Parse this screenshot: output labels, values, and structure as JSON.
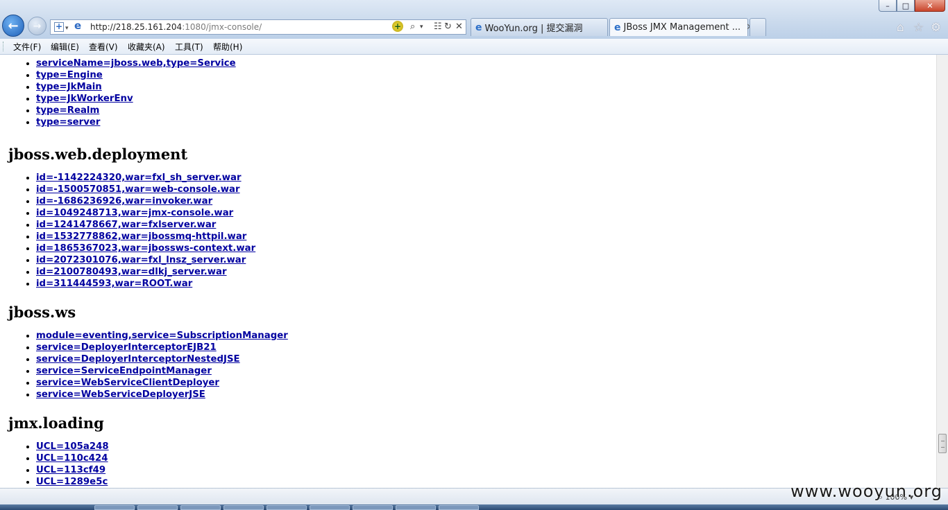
{
  "window": {
    "minimize": "–",
    "maximize": "□",
    "close": "✕"
  },
  "nav": {
    "back_icon": "back-arrow-icon",
    "forward_icon": "forward-arrow-icon"
  },
  "address_bar": {
    "url_host": "http://218.25.161.204",
    "url_rest": ":1080/jmx-console/"
  },
  "tabs": [
    {
      "label": "WooYun.org | 提交漏洞",
      "active": false
    },
    {
      "label": "JBoss JMX Management ...",
      "active": true
    }
  ],
  "menu": [
    "文件(F)",
    "编辑(E)",
    "查看(V)",
    "收藏夹(A)",
    "工具(T)",
    "帮助(H)"
  ],
  "sections": {
    "top_list": [
      "serviceName=jboss.web,type=Service",
      "type=Engine",
      "type=JkMain",
      "type=JkWorkerEnv",
      "type=Realm",
      "type=server"
    ],
    "web_deployment": {
      "heading": "jboss.web.deployment",
      "items": [
        "id=-1142224320,war=fxl_sh_server.war",
        "id=-1500570851,war=web-console.war",
        "id=-1686236926,war=invoker.war",
        "id=1049248713,war=jmx-console.war",
        "id=1241478667,war=fxlserver.war",
        "id=1532778862,war=jbossmq-httpil.war",
        "id=1865367023,war=jbossws-context.war",
        "id=2072301076,war=fxl_lnsz_server.war",
        "id=2100780493,war=dlkj_server.war",
        "id=311444593,war=ROOT.war"
      ]
    },
    "ws": {
      "heading": "jboss.ws",
      "items": [
        "module=eventing,service=SubscriptionManager",
        "service=DeployerInterceptorEJB21",
        "service=DeployerInterceptorNestedJSE",
        "service=ServiceEndpointManager",
        "service=WebServiceClientDeployer",
        "service=WebServiceDeployerJSE"
      ]
    },
    "loading": {
      "heading": "jmx.loading",
      "items": [
        "UCL=105a248",
        "UCL=110c424",
        "UCL=113cf49",
        "UCL=1289e5c"
      ]
    }
  },
  "status": {
    "zoom": "100%",
    "watermark": "www.wooyun.org"
  }
}
